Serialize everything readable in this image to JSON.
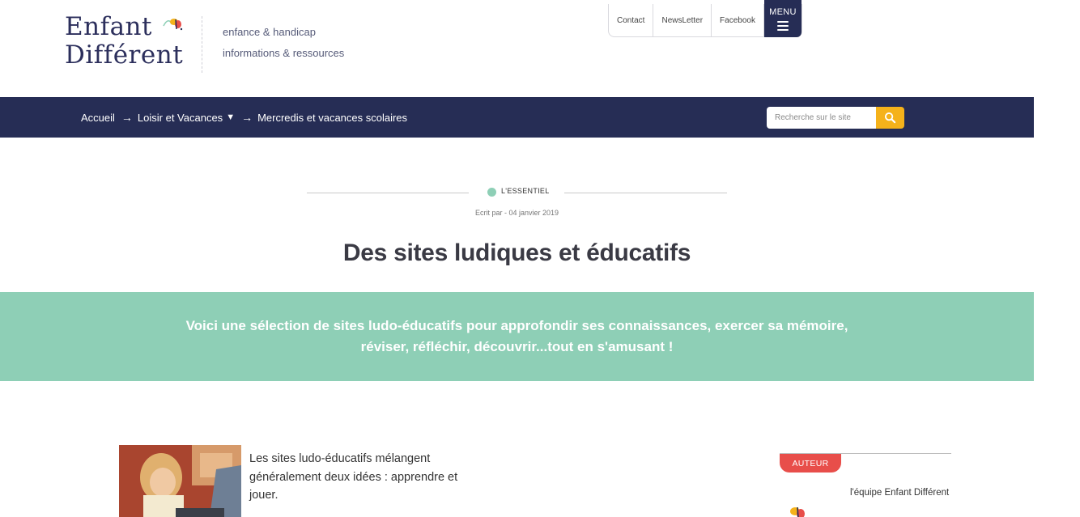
{
  "header": {
    "logo_line1": "Enfant",
    "logo_line2": "Différent",
    "tagline_1": "enfance & handicap",
    "tagline_2": "informations & ressources",
    "top_links": [
      "Contact",
      "NewsLetter",
      "Facebook"
    ],
    "menu_label": "MENU"
  },
  "nav": {
    "breadcrumb": {
      "home": "Accueil",
      "section": "Loisir et Vacances",
      "current": "Mercredis et vacances scolaires",
      "arrow": "→",
      "dropdown": "▼"
    },
    "search_placeholder": "Recherche sur le site"
  },
  "article": {
    "category": "L'ESSENTIEL",
    "byline": "Ecrit par - 04 janvier 2019",
    "title": "Des sites ludiques et éducatifs",
    "intro": "Voici une sélection de sites ludo-éducatifs pour approfondir ses connaissances, exercer sa mémoire, réviser, réfléchir, découvrir...tout en s'amusant !",
    "lead": "Les sites ludo-éducatifs mélangent généralement deux idées : apprendre et jouer."
  },
  "sidebar": {
    "author_badge": "AUTEUR",
    "author_name": "l'équipe Enfant Différent"
  },
  "colors": {
    "navy": "#262d55",
    "mint": "#8ecfb6",
    "coral": "#e84e4a",
    "yellow": "#f5b21a"
  }
}
